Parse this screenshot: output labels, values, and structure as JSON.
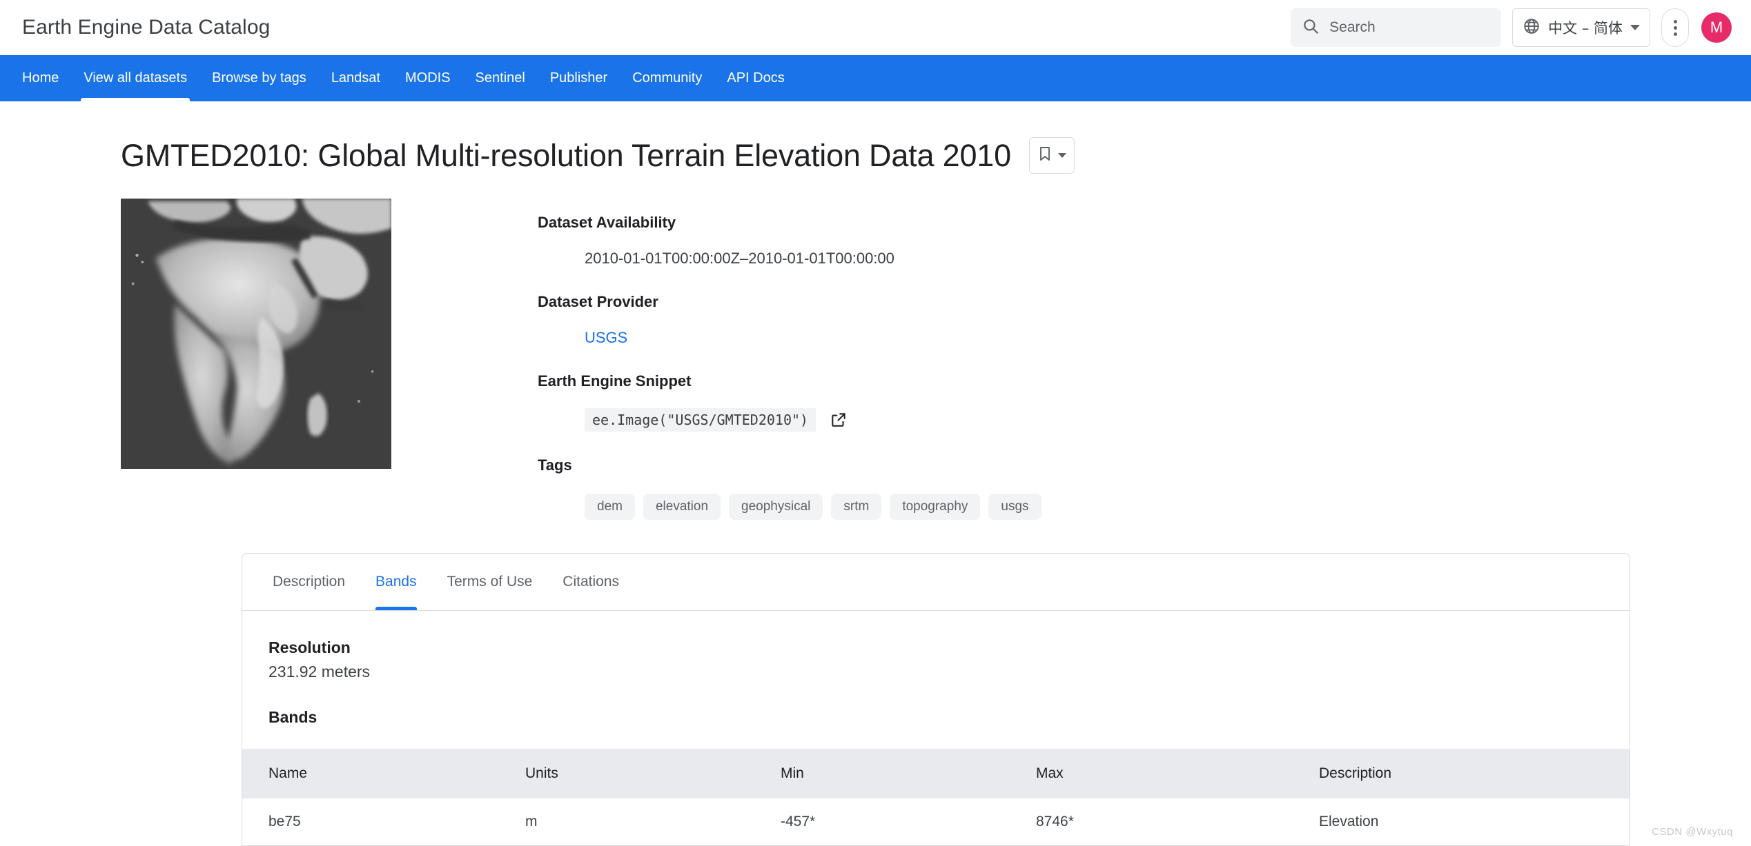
{
  "header": {
    "brand": "Earth Engine Data Catalog",
    "search": {
      "placeholder": "Search",
      "value": "",
      "icon": "search-icon"
    },
    "language": {
      "label": "中文 – 简体",
      "icon": "globe-icon",
      "caret": "chevron-down-icon"
    },
    "more_menu_icon": "kebab-menu-icon",
    "avatar_initial": "M",
    "avatar_color": "#e52b68"
  },
  "nav": {
    "accent_color": "#1a73e8",
    "items": [
      {
        "label": "Home",
        "active": false
      },
      {
        "label": "View all datasets",
        "active": true
      },
      {
        "label": "Browse by tags",
        "active": false
      },
      {
        "label": "Landsat",
        "active": false
      },
      {
        "label": "MODIS",
        "active": false
      },
      {
        "label": "Sentinel",
        "active": false
      },
      {
        "label": "Publisher",
        "active": false
      },
      {
        "label": "Community",
        "active": false
      },
      {
        "label": "API Docs",
        "active": false
      }
    ]
  },
  "dataset": {
    "title": "GMTED2010: Global Multi-resolution Terrain Elevation Data 2010",
    "bookmark_icon": "bookmark-icon",
    "thumbnail_alt": "Grayscale global elevation map centered on Africa",
    "availability_label": "Dataset Availability",
    "availability_value": "2010-01-01T00:00:00Z–2010-01-01T00:00:00",
    "provider_label": "Dataset Provider",
    "provider_value": "USGS",
    "snippet_label": "Earth Engine Snippet",
    "snippet_code": "ee.Image(\"USGS/GMTED2010\")",
    "snippet_open_icon": "open-in-new-icon",
    "tags_label": "Tags",
    "tags": [
      "dem",
      "elevation",
      "geophysical",
      "srtm",
      "topography",
      "usgs"
    ],
    "link_color": "#1a73e8"
  },
  "tabs": [
    {
      "label": "Description",
      "active": false
    },
    {
      "label": "Bands",
      "active": true
    },
    {
      "label": "Terms of Use",
      "active": false
    },
    {
      "label": "Citations",
      "active": false
    }
  ],
  "bands_panel": {
    "resolution_label": "Resolution",
    "resolution_value": "231.92 meters",
    "bands_label": "Bands",
    "columns": [
      "Name",
      "Units",
      "Min",
      "Max",
      "Description"
    ],
    "rows": [
      {
        "name": "be75",
        "units": "m",
        "min": "-457*",
        "max": "8746*",
        "description": "Elevation"
      }
    ]
  },
  "watermark": "CSDN @Wxytuq"
}
